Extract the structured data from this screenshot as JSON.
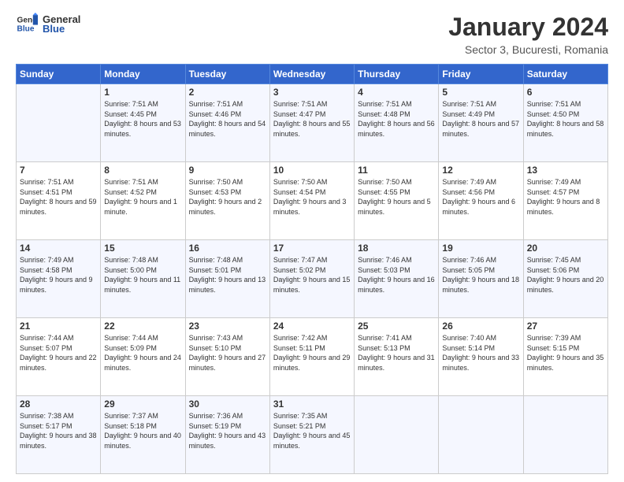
{
  "header": {
    "logo_general": "General",
    "logo_blue": "Blue",
    "month_title": "January 2024",
    "subtitle": "Sector 3, Bucuresti, Romania"
  },
  "weekdays": [
    "Sunday",
    "Monday",
    "Tuesday",
    "Wednesday",
    "Thursday",
    "Friday",
    "Saturday"
  ],
  "weeks": [
    [
      {
        "day": "",
        "sunrise": "",
        "sunset": "",
        "daylight": ""
      },
      {
        "day": "1",
        "sunrise": "Sunrise: 7:51 AM",
        "sunset": "Sunset: 4:45 PM",
        "daylight": "Daylight: 8 hours and 53 minutes."
      },
      {
        "day": "2",
        "sunrise": "Sunrise: 7:51 AM",
        "sunset": "Sunset: 4:46 PM",
        "daylight": "Daylight: 8 hours and 54 minutes."
      },
      {
        "day": "3",
        "sunrise": "Sunrise: 7:51 AM",
        "sunset": "Sunset: 4:47 PM",
        "daylight": "Daylight: 8 hours and 55 minutes."
      },
      {
        "day": "4",
        "sunrise": "Sunrise: 7:51 AM",
        "sunset": "Sunset: 4:48 PM",
        "daylight": "Daylight: 8 hours and 56 minutes."
      },
      {
        "day": "5",
        "sunrise": "Sunrise: 7:51 AM",
        "sunset": "Sunset: 4:49 PM",
        "daylight": "Daylight: 8 hours and 57 minutes."
      },
      {
        "day": "6",
        "sunrise": "Sunrise: 7:51 AM",
        "sunset": "Sunset: 4:50 PM",
        "daylight": "Daylight: 8 hours and 58 minutes."
      }
    ],
    [
      {
        "day": "7",
        "sunrise": "Sunrise: 7:51 AM",
        "sunset": "Sunset: 4:51 PM",
        "daylight": "Daylight: 8 hours and 59 minutes."
      },
      {
        "day": "8",
        "sunrise": "Sunrise: 7:51 AM",
        "sunset": "Sunset: 4:52 PM",
        "daylight": "Daylight: 9 hours and 1 minute."
      },
      {
        "day": "9",
        "sunrise": "Sunrise: 7:50 AM",
        "sunset": "Sunset: 4:53 PM",
        "daylight": "Daylight: 9 hours and 2 minutes."
      },
      {
        "day": "10",
        "sunrise": "Sunrise: 7:50 AM",
        "sunset": "Sunset: 4:54 PM",
        "daylight": "Daylight: 9 hours and 3 minutes."
      },
      {
        "day": "11",
        "sunrise": "Sunrise: 7:50 AM",
        "sunset": "Sunset: 4:55 PM",
        "daylight": "Daylight: 9 hours and 5 minutes."
      },
      {
        "day": "12",
        "sunrise": "Sunrise: 7:49 AM",
        "sunset": "Sunset: 4:56 PM",
        "daylight": "Daylight: 9 hours and 6 minutes."
      },
      {
        "day": "13",
        "sunrise": "Sunrise: 7:49 AM",
        "sunset": "Sunset: 4:57 PM",
        "daylight": "Daylight: 9 hours and 8 minutes."
      }
    ],
    [
      {
        "day": "14",
        "sunrise": "Sunrise: 7:49 AM",
        "sunset": "Sunset: 4:58 PM",
        "daylight": "Daylight: 9 hours and 9 minutes."
      },
      {
        "day": "15",
        "sunrise": "Sunrise: 7:48 AM",
        "sunset": "Sunset: 5:00 PM",
        "daylight": "Daylight: 9 hours and 11 minutes."
      },
      {
        "day": "16",
        "sunrise": "Sunrise: 7:48 AM",
        "sunset": "Sunset: 5:01 PM",
        "daylight": "Daylight: 9 hours and 13 minutes."
      },
      {
        "day": "17",
        "sunrise": "Sunrise: 7:47 AM",
        "sunset": "Sunset: 5:02 PM",
        "daylight": "Daylight: 9 hours and 15 minutes."
      },
      {
        "day": "18",
        "sunrise": "Sunrise: 7:46 AM",
        "sunset": "Sunset: 5:03 PM",
        "daylight": "Daylight: 9 hours and 16 minutes."
      },
      {
        "day": "19",
        "sunrise": "Sunrise: 7:46 AM",
        "sunset": "Sunset: 5:05 PM",
        "daylight": "Daylight: 9 hours and 18 minutes."
      },
      {
        "day": "20",
        "sunrise": "Sunrise: 7:45 AM",
        "sunset": "Sunset: 5:06 PM",
        "daylight": "Daylight: 9 hours and 20 minutes."
      }
    ],
    [
      {
        "day": "21",
        "sunrise": "Sunrise: 7:44 AM",
        "sunset": "Sunset: 5:07 PM",
        "daylight": "Daylight: 9 hours and 22 minutes."
      },
      {
        "day": "22",
        "sunrise": "Sunrise: 7:44 AM",
        "sunset": "Sunset: 5:09 PM",
        "daylight": "Daylight: 9 hours and 24 minutes."
      },
      {
        "day": "23",
        "sunrise": "Sunrise: 7:43 AM",
        "sunset": "Sunset: 5:10 PM",
        "daylight": "Daylight: 9 hours and 27 minutes."
      },
      {
        "day": "24",
        "sunrise": "Sunrise: 7:42 AM",
        "sunset": "Sunset: 5:11 PM",
        "daylight": "Daylight: 9 hours and 29 minutes."
      },
      {
        "day": "25",
        "sunrise": "Sunrise: 7:41 AM",
        "sunset": "Sunset: 5:13 PM",
        "daylight": "Daylight: 9 hours and 31 minutes."
      },
      {
        "day": "26",
        "sunrise": "Sunrise: 7:40 AM",
        "sunset": "Sunset: 5:14 PM",
        "daylight": "Daylight: 9 hours and 33 minutes."
      },
      {
        "day": "27",
        "sunrise": "Sunrise: 7:39 AM",
        "sunset": "Sunset: 5:15 PM",
        "daylight": "Daylight: 9 hours and 35 minutes."
      }
    ],
    [
      {
        "day": "28",
        "sunrise": "Sunrise: 7:38 AM",
        "sunset": "Sunset: 5:17 PM",
        "daylight": "Daylight: 9 hours and 38 minutes."
      },
      {
        "day": "29",
        "sunrise": "Sunrise: 7:37 AM",
        "sunset": "Sunset: 5:18 PM",
        "daylight": "Daylight: 9 hours and 40 minutes."
      },
      {
        "day": "30",
        "sunrise": "Sunrise: 7:36 AM",
        "sunset": "Sunset: 5:19 PM",
        "daylight": "Daylight: 9 hours and 43 minutes."
      },
      {
        "day": "31",
        "sunrise": "Sunrise: 7:35 AM",
        "sunset": "Sunset: 5:21 PM",
        "daylight": "Daylight: 9 hours and 45 minutes."
      },
      {
        "day": "",
        "sunrise": "",
        "sunset": "",
        "daylight": ""
      },
      {
        "day": "",
        "sunrise": "",
        "sunset": "",
        "daylight": ""
      },
      {
        "day": "",
        "sunrise": "",
        "sunset": "",
        "daylight": ""
      }
    ]
  ]
}
